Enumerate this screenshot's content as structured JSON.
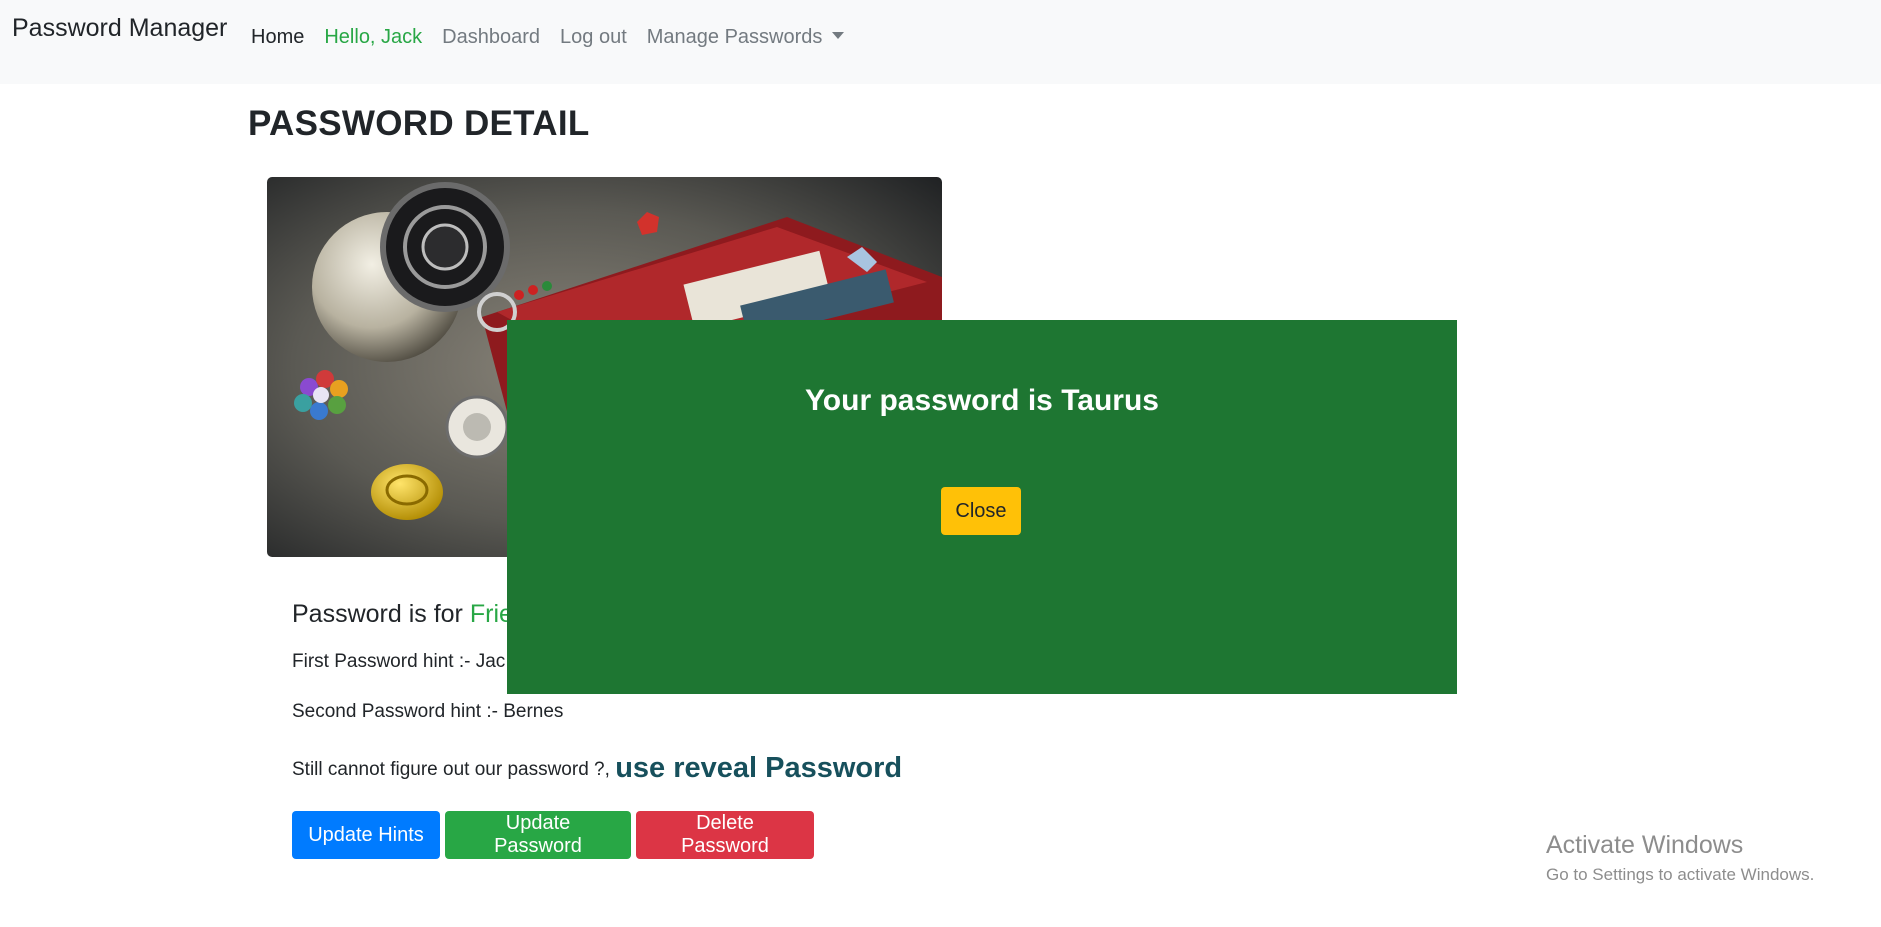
{
  "navbar": {
    "brand": "Password Manager",
    "items": [
      {
        "label": "Home"
      },
      {
        "label": "Hello, Jack"
      },
      {
        "label": "Dashboard"
      },
      {
        "label": "Log out"
      },
      {
        "label": "Manage Passwords"
      }
    ]
  },
  "page": {
    "title": "PASSWORD DETAIL"
  },
  "detail": {
    "for_prefix": "Password is for",
    "site_name": "Frie",
    "first_hint": "First Password hint :- Jac",
    "second_hint": "Second Password hint :- Bernes",
    "reveal_prompt": "Still cannot figure out our password ?,",
    "reveal_link": "use reveal Password"
  },
  "buttons": {
    "update_hints": "Update Hints",
    "update_password": "Update Password",
    "delete_password": "Delete Password"
  },
  "modal": {
    "message": "Your password is Taurus",
    "close": "Close",
    "background": "#1e7632"
  },
  "watermark": {
    "title": "Activate Windows",
    "subtitle": "Go to Settings to activate Windows."
  },
  "colors": {
    "primary": "#007bff",
    "success": "#28a745",
    "danger": "#dc3545",
    "warning": "#ffc107",
    "link": "#17505c"
  }
}
